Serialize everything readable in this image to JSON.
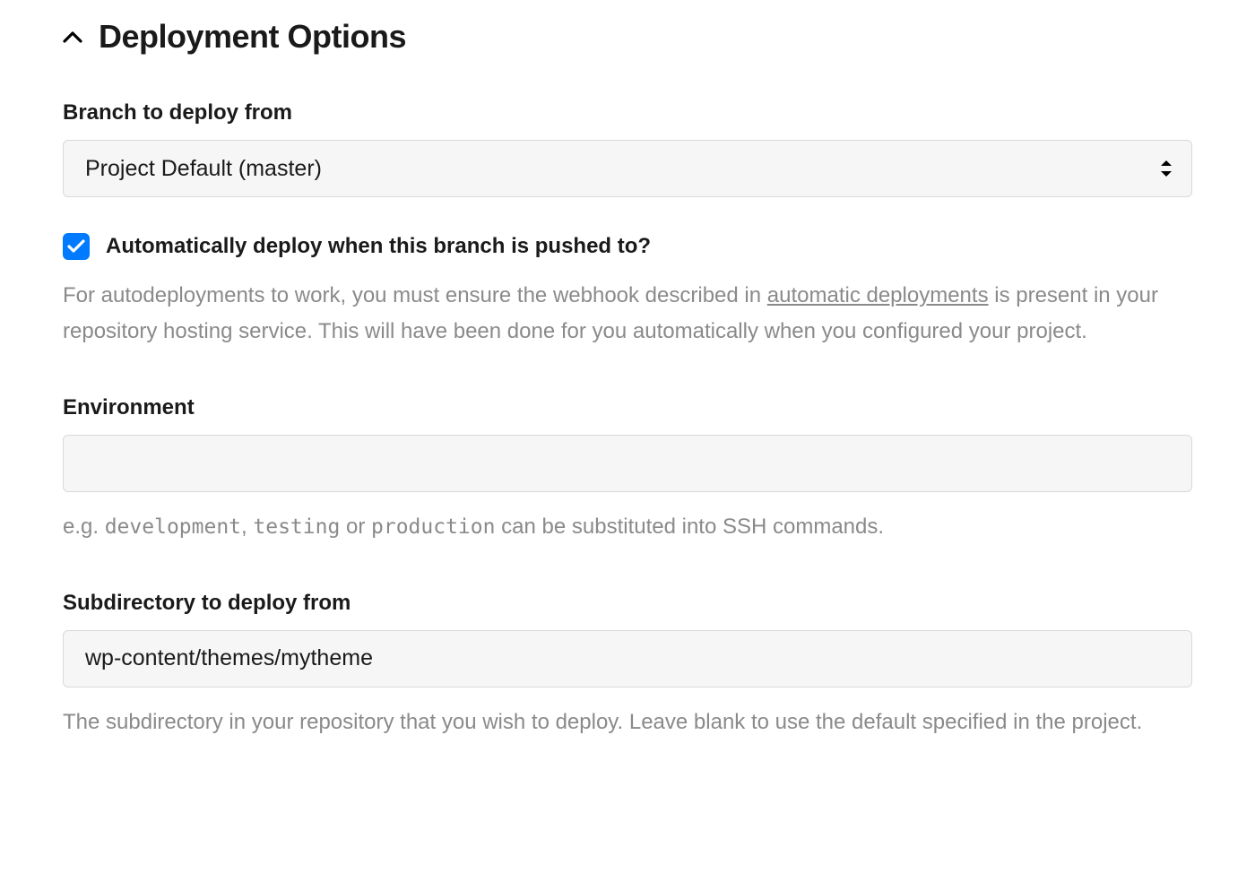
{
  "section": {
    "title": "Deployment Options"
  },
  "branch": {
    "label": "Branch to deploy from",
    "value": "Project Default (master)"
  },
  "autodeploy": {
    "checked": true,
    "label": "Automatically deploy when this branch is pushed to?",
    "help_before": "For autodeployments to work, you must ensure the webhook described in ",
    "help_link": "automatic deployments",
    "help_after": " is present in your repository hosting service. This will have been done for you automatically when you configured your project."
  },
  "environment": {
    "label": "Environment",
    "value": "",
    "help_prefix": "e.g. ",
    "help_code1": "development",
    "help_sep1": ", ",
    "help_code2": "testing",
    "help_sep2": " or ",
    "help_code3": "production",
    "help_suffix": " can be substituted into SSH commands."
  },
  "subdir": {
    "label": "Subdirectory to deploy from",
    "value": "wp-content/themes/mytheme",
    "help": "The subdirectory in your repository that you wish to deploy. Leave blank to use the default specified in the project."
  }
}
